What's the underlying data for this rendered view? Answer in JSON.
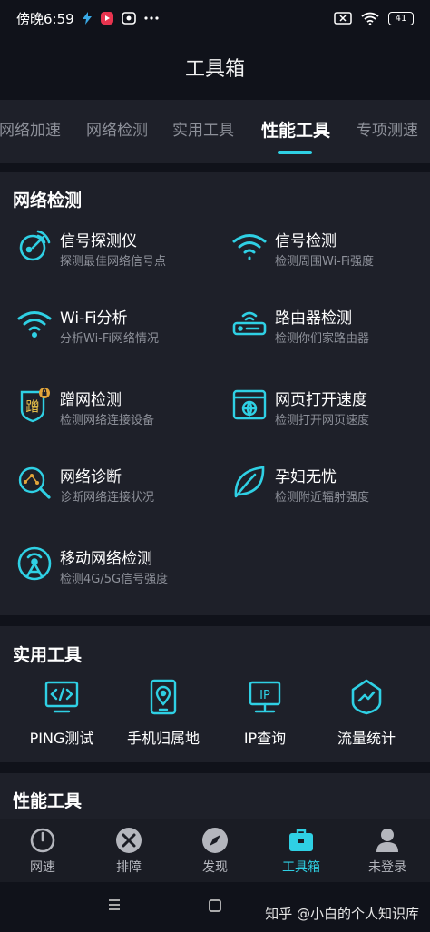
{
  "status_bar": {
    "time": "傍晚6:59",
    "battery": "41"
  },
  "header": {
    "title": "工具箱"
  },
  "tabs": [
    {
      "label": "网络加速",
      "active": false
    },
    {
      "label": "网络检测",
      "active": false
    },
    {
      "label": "实用工具",
      "active": false
    },
    {
      "label": "性能工具",
      "active": true
    },
    {
      "label": "专项测速",
      "active": false
    }
  ],
  "network_section": {
    "title": "网络检测",
    "items": [
      {
        "title": "信号探测仪",
        "subtitle": "探测最佳网络信号点",
        "icon": "radar-icon"
      },
      {
        "title": "信号检测",
        "subtitle": "检测周围Wi-Fi强度",
        "icon": "wifi-signal-icon"
      },
      {
        "title": "Wi-Fi分析",
        "subtitle": "分析Wi-Fi网络情况",
        "icon": "wifi-icon"
      },
      {
        "title": "路由器检测",
        "subtitle": "检测你们家路由器",
        "icon": "router-icon"
      },
      {
        "title": "蹭网检测",
        "subtitle": "检测网络连接设备",
        "icon": "leech-shield-icon",
        "badge_char": "蹭"
      },
      {
        "title": "网页打开速度",
        "subtitle": "检测打开网页速度",
        "icon": "webpage-globe-icon"
      },
      {
        "title": "网络诊断",
        "subtitle": "诊断网络连接状况",
        "icon": "network-diagnose-icon"
      },
      {
        "title": "孕妇无忧",
        "subtitle": "检测附近辐射强度",
        "icon": "leaf-icon"
      },
      {
        "title": "移动网络检测",
        "subtitle": "检测4G/5G信号强度",
        "icon": "cell-tower-icon"
      }
    ]
  },
  "utility_section": {
    "title": "实用工具",
    "items": [
      {
        "label": "PING测试",
        "icon": "code-monitor-icon"
      },
      {
        "label": "手机归属地",
        "icon": "phone-location-icon"
      },
      {
        "label": "IP查询",
        "icon": "ip-monitor-icon",
        "icon_text": "IP"
      },
      {
        "label": "流量统计",
        "icon": "traffic-shield-icon"
      }
    ]
  },
  "performance_section": {
    "title": "性能工具"
  },
  "bottom_nav": [
    {
      "label": "网速",
      "icon": "speedometer-icon",
      "active": false
    },
    {
      "label": "排障",
      "icon": "tools-icon",
      "active": false
    },
    {
      "label": "发现",
      "icon": "compass-icon",
      "active": false
    },
    {
      "label": "工具箱",
      "icon": "toolbox-icon",
      "active": true
    },
    {
      "label": "未登录",
      "icon": "user-icon",
      "active": false
    }
  ],
  "watermark": "知乎 @小白的个人知识库",
  "colors": {
    "accent": "#2fd0e4",
    "background": "#10121a",
    "card": "#1e2029",
    "muted_text": "#8d9099"
  }
}
